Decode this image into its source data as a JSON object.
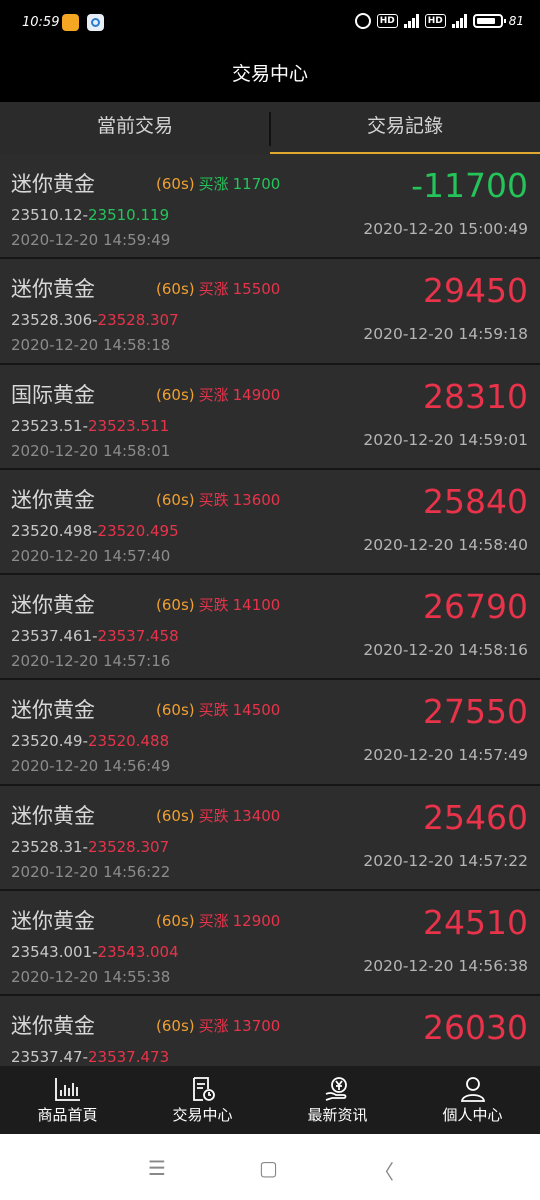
{
  "status_bar": {
    "time": "10:59",
    "network1": "4G",
    "network2": "5G",
    "hd": "HD",
    "battery": "81"
  },
  "header": {
    "title": "交易中心"
  },
  "tabs": [
    {
      "label": "當前交易",
      "active": false
    },
    {
      "label": "交易記錄",
      "active": true
    }
  ],
  "colors": {
    "up": "#e8334a",
    "down": "#25c45a",
    "duration": "#f0a030",
    "accent": "#e0a82e"
  },
  "trades": [
    {
      "name": "迷你黄金",
      "duration": "(60s)",
      "direction": "买涨",
      "amount": "11700",
      "open_price": "23510.12-",
      "close_price": "23510.119",
      "open_time": "2020-12-20 14:59:49",
      "profit": "-11700",
      "close_time": "2020-12-20 15:00:49",
      "status": "loss"
    },
    {
      "name": "迷你黄金",
      "duration": "(60s)",
      "direction": "买涨",
      "amount": "15500",
      "open_price": "23528.306-",
      "close_price": "23528.307",
      "open_time": "2020-12-20 14:58:18",
      "profit": "29450",
      "close_time": "2020-12-20 14:59:18",
      "status": "win"
    },
    {
      "name": "国际黄金",
      "duration": "(60s)",
      "direction": "买涨",
      "amount": "14900",
      "open_price": "23523.51-",
      "close_price": "23523.511",
      "open_time": "2020-12-20 14:58:01",
      "profit": "28310",
      "close_time": "2020-12-20 14:59:01",
      "status": "win"
    },
    {
      "name": "迷你黄金",
      "duration": "(60s)",
      "direction": "买跌",
      "amount": "13600",
      "open_price": "23520.498-",
      "close_price": "23520.495",
      "open_time": "2020-12-20 14:57:40",
      "profit": "25840",
      "close_time": "2020-12-20 14:58:40",
      "status": "win"
    },
    {
      "name": "迷你黄金",
      "duration": "(60s)",
      "direction": "买跌",
      "amount": "14100",
      "open_price": "23537.461-",
      "close_price": "23537.458",
      "open_time": "2020-12-20 14:57:16",
      "profit": "26790",
      "close_time": "2020-12-20 14:58:16",
      "status": "win"
    },
    {
      "name": "迷你黄金",
      "duration": "(60s)",
      "direction": "买跌",
      "amount": "14500",
      "open_price": "23520.49-",
      "close_price": "23520.488",
      "open_time": "2020-12-20 14:56:49",
      "profit": "27550",
      "close_time": "2020-12-20 14:57:49",
      "status": "win"
    },
    {
      "name": "迷你黄金",
      "duration": "(60s)",
      "direction": "买跌",
      "amount": "13400",
      "open_price": "23528.31-",
      "close_price": "23528.307",
      "open_time": "2020-12-20 14:56:22",
      "profit": "25460",
      "close_time": "2020-12-20 14:57:22",
      "status": "win"
    },
    {
      "name": "迷你黄金",
      "duration": "(60s)",
      "direction": "买涨",
      "amount": "12900",
      "open_price": "23543.001-",
      "close_price": "23543.004",
      "open_time": "2020-12-20 14:55:38",
      "profit": "24510",
      "close_time": "2020-12-20 14:56:38",
      "status": "win"
    },
    {
      "name": "迷你黄金",
      "duration": "(60s)",
      "direction": "买涨",
      "amount": "13700",
      "open_price": "23537.47-",
      "close_price": "23537.473",
      "open_time": "",
      "profit": "26030",
      "close_time": "",
      "status": "win"
    }
  ],
  "bottom_nav": [
    {
      "label": "商品首頁",
      "icon": "chart-icon"
    },
    {
      "label": "交易中心",
      "icon": "document-clock-icon"
    },
    {
      "label": "最新资讯",
      "icon": "yen-hand-icon"
    },
    {
      "label": "個人中心",
      "icon": "person-icon"
    }
  ],
  "system_nav": {
    "menu": "☰",
    "home": "▢",
    "back": "〈"
  }
}
